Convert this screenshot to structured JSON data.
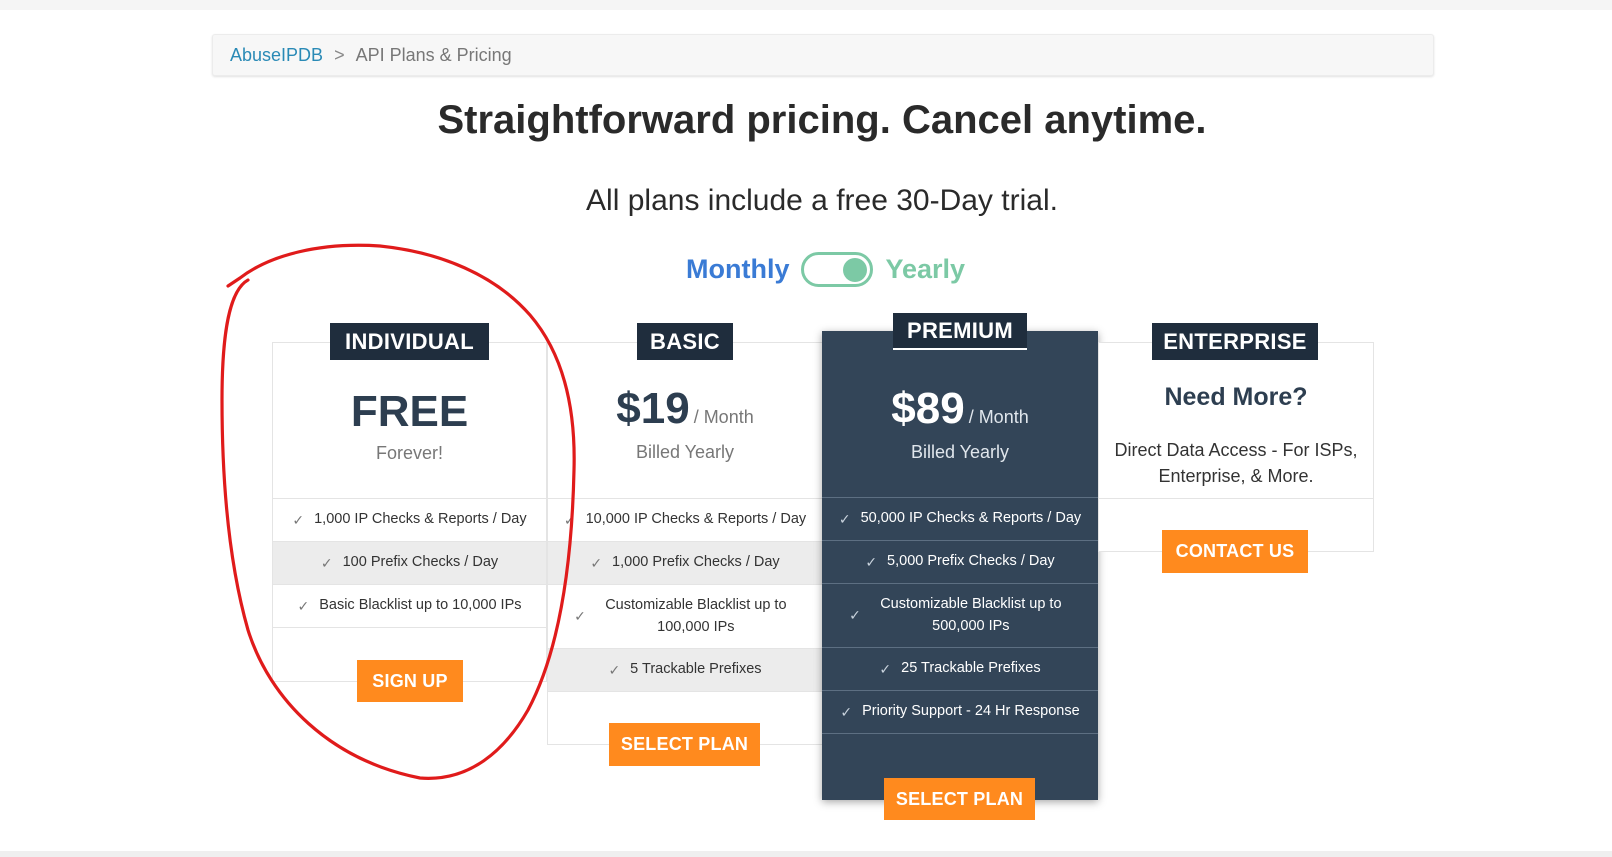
{
  "breadcrumb": {
    "home": "AbuseIPDB",
    "separator": ">",
    "current": "API Plans & Pricing"
  },
  "headline": "Straightforward pricing. Cancel anytime.",
  "subline": "All plans include a free 30-Day trial.",
  "billing_toggle": {
    "left_label": "Monthly",
    "right_label": "Yearly",
    "selected": "Yearly"
  },
  "plans": [
    {
      "name": "INDIVIDUAL",
      "price": "FREE",
      "per": "",
      "note": "Forever!",
      "features": [
        "1,000 IP Checks & Reports / Day",
        "100 Prefix Checks / Day",
        "Basic Blacklist up to 10,000 IPs"
      ],
      "button": "SIGN UP"
    },
    {
      "name": "BASIC",
      "price": "$19",
      "per": "/ Month",
      "note": "Billed Yearly",
      "features": [
        "10,000 IP Checks & Reports / Day",
        "1,000 Prefix Checks / Day",
        "Customizable Blacklist up to 100,000 IPs",
        "5 Trackable Prefixes"
      ],
      "button": "SELECT PLAN"
    },
    {
      "name": "PREMIUM",
      "price": "$89",
      "per": "/ Month",
      "note": "Billed Yearly",
      "features": [
        "50,000 IP Checks & Reports / Day",
        "5,000 Prefix Checks / Day",
        "Customizable Blacklist up to 500,000 IPs",
        "25 Trackable Prefixes",
        "Priority Support - 24 Hr Response"
      ],
      "button": "SELECT PLAN"
    },
    {
      "name": "ENTERPRISE",
      "title": "Need More?",
      "desc_line1": "Direct Data Access - For ISPs,",
      "desc_line2": "Enterprise, & More.",
      "button": "CONTACT US"
    }
  ],
  "colors": {
    "link": "#2a8ab6",
    "dark_card": "#334558",
    "tag": "#1f2d3d",
    "button": "#ff8a1e",
    "monthly": "#3a7bd5",
    "yearly": "#7cc9a5",
    "annotation": "#e01b1b"
  },
  "icons": {
    "feature_bullet": "check-icon"
  }
}
